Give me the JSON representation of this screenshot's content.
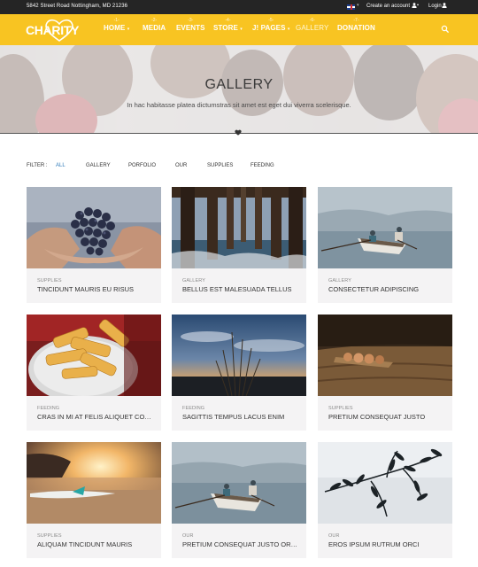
{
  "topbar": {
    "address": "5842 Street Road Nottingham, MD 21236",
    "create_account": "Create an account",
    "login": "Login"
  },
  "logo": {
    "text": "CHARITY"
  },
  "nav": [
    {
      "num": "-1-",
      "label": "HOME",
      "dropdown": "▾"
    },
    {
      "num": "-2-",
      "label": "MEDIA",
      "dropdown": ""
    },
    {
      "num": "-3-",
      "label": "EVENTS",
      "dropdown": ""
    },
    {
      "num": "-4-",
      "label": "STORE",
      "dropdown": "▾"
    },
    {
      "num": "-5-",
      "label": "J! PAGES",
      "dropdown": "▾"
    },
    {
      "num": "-6-",
      "label": "GALLERY",
      "dropdown": ""
    },
    {
      "num": "-7-",
      "label": "DONATION",
      "dropdown": ""
    }
  ],
  "hero": {
    "title": "GALLERY",
    "subtitle": "In hac habitasse platea dictumstras sit amet est eget dui viverra scelerisque."
  },
  "filter": {
    "label": "FILTER :",
    "options": [
      "ALL",
      "GALLERY",
      "PORFOLIO",
      "OUR",
      "SUPPLIES",
      "FEEDING"
    ],
    "active": "ALL"
  },
  "cards": [
    {
      "category": "SUPPLIES",
      "title": "TINCIDUNT MAURIS EU RISUS",
      "image": "grapes-in-hands"
    },
    {
      "category": "GALLERY",
      "title": "BELLUS EST MALESUADA TELLUS",
      "image": "pier-pillars"
    },
    {
      "category": "GALLERY",
      "title": "CONSECTETUR ADIPISCING",
      "image": "rowing-boat"
    },
    {
      "category": "FEEDING",
      "title": "CRAS IN MI AT FELIS ALIQUET CONGUE",
      "image": "french-fries"
    },
    {
      "category": "FEEDING",
      "title": "SAGITTIS TEMPUS LACUS ENIM",
      "image": "grass-sunset"
    },
    {
      "category": "SUPPLIES",
      "title": "PRETIUM CONSEQUAT JUSTO",
      "image": "beads-on-wood"
    },
    {
      "category": "SUPPLIES",
      "title": "ALIQUAM TINCIDUNT MAURIS",
      "image": "surfboard-beach"
    },
    {
      "category": "OUR",
      "title": "PRETIUM CONSEQUAT JUSTO ORNARE",
      "image": "rowing-boat-2"
    },
    {
      "category": "OUR",
      "title": "EROS IPSUM RUTRUM ORCI",
      "image": "olive-branch"
    }
  ],
  "colors": {
    "brand_yellow": "#f8c422",
    "topbar_dark": "#252525",
    "filter_active": "#2f7ab9",
    "card_bg": "#f4f3f4"
  }
}
